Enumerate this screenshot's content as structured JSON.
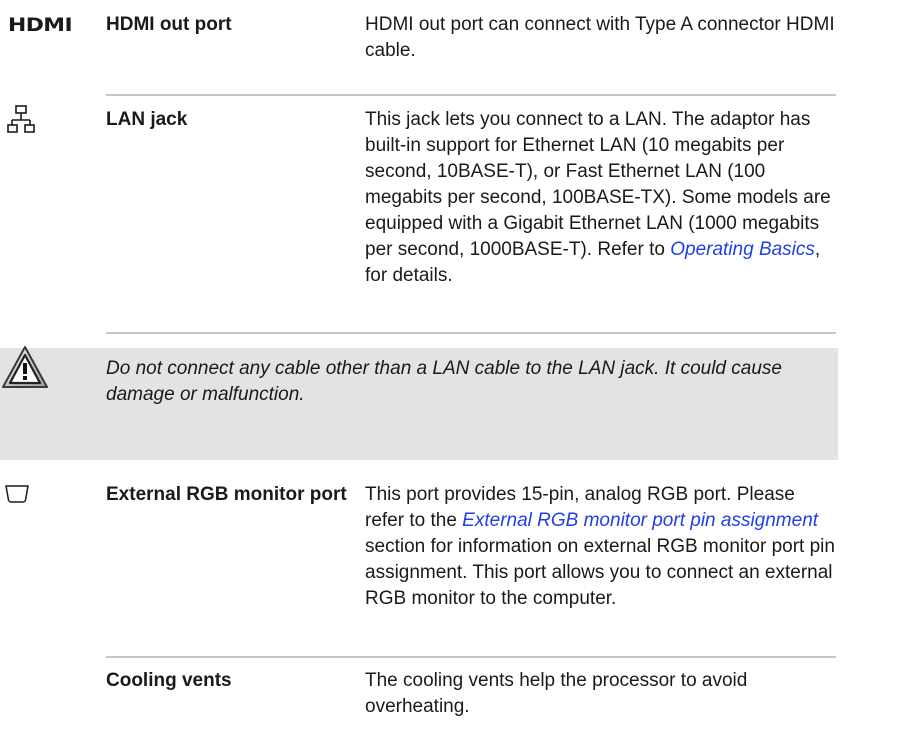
{
  "entries": [
    {
      "id": "hdmi",
      "icon": "hdmi-icon",
      "icon_text": "HDMI",
      "term": "HDMI out port",
      "description": "HDMI out port can connect with Type A connector HDMI cable."
    },
    {
      "id": "lan",
      "icon": "lan-network-icon",
      "term": "LAN jack",
      "description_before": "This jack lets you connect to a LAN. The adaptor has built-in support for Ethernet LAN (10 megabits per second, 10BASE-T), or Fast Ethernet LAN (100 megabits per second, 100BASE-TX). Some models are equipped with a Gigabit Ethernet LAN (1000 megabits per second, 1000BASE-T). Refer to ",
      "link": "Operating Basics",
      "description_after": ", for details."
    },
    {
      "id": "rgb",
      "icon": "rgb-monitor-port-icon",
      "term": "External RGB monitor port",
      "description_before": "This port provides 15-pin, analog RGB port. Please refer to the ",
      "link": "External RGB monitor port pin assignment",
      "description_after": " section for information on external RGB monitor port pin assignment. This port allows you to connect an external RGB monitor to the computer."
    },
    {
      "id": "cooling",
      "term": "Cooling vents",
      "description": "The cooling vents help the processor to avoid overheating."
    }
  ],
  "caution": {
    "icon": "warning-triangle-icon",
    "text": "Do not connect any cable other than a LAN cable to the LAN jack. It could cause damage or malfunction."
  },
  "colors": {
    "link": "#1f3fe6",
    "caution_background": "#e3e3e3",
    "separator": "#c4c4c4"
  }
}
